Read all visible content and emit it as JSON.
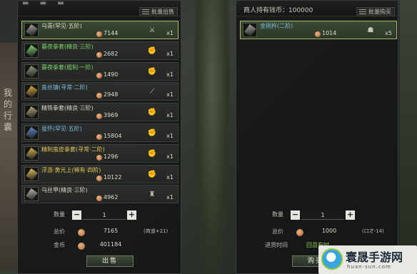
{
  "background": {
    "side_text": [
      "我",
      "的",
      "行",
      "囊"
    ]
  },
  "left_panel": {
    "batch_label": "批量出售",
    "items": [
      {
        "name": "乌青(罕见·五阶)",
        "price": "7144",
        "qty": "x1",
        "type_icon": "sword-icon",
        "color": "white",
        "selected": true
      },
      {
        "name": "暮夜拳套(精良·三阶)",
        "price": "2682",
        "qty": "x1",
        "type_icon": "fist-icon",
        "color": "green"
      },
      {
        "name": "暮夜拳套(粗制·一阶)",
        "price": "1490",
        "qty": "x1",
        "type_icon": "fist-icon",
        "color": "green"
      },
      {
        "name": "蛮丝镰(寻常·二阶)",
        "price": "2948",
        "qty": "x1",
        "type_icon": "blade-icon",
        "color": "blue"
      },
      {
        "name": "精铁拳套(精良·三阶)",
        "price": "3969",
        "qty": "x1",
        "type_icon": "fist-icon",
        "color": "white"
      },
      {
        "name": "虽怀(罕见·五阶)",
        "price": "15804",
        "qty": "x1",
        "type_icon": "fist-icon",
        "color": "blue"
      },
      {
        "name": "精制蛮皮拳套(寻常·二阶)",
        "price": "1296",
        "qty": "x1",
        "type_icon": "fist-icon",
        "color": "gold"
      },
      {
        "name": "浮游·黄元上(稀有·四阶)",
        "price": "10122",
        "qty": "x1",
        "type_icon": "fist-icon",
        "color": "gold"
      },
      {
        "name": "乌丝甲(精良·三阶)",
        "price": "4962",
        "qty": "x1",
        "type_icon": "armor-icon",
        "color": "white"
      }
    ],
    "quantity_label": "数量",
    "quantity_value": "1",
    "total_label": "总价",
    "total_value": "7165",
    "total_note": "(商道+21)",
    "coin_label": "金币",
    "coin_value": "401184",
    "action_label": "出售"
  },
  "right_panel": {
    "merchant_money": "商人持有钱币：100000",
    "batch_label": "批量购买",
    "items": [
      {
        "name": "金刚杵(二阶)",
        "price": "1014",
        "qty": "x5",
        "type_icon": "helmet-icon",
        "color": "blue",
        "selected": true
      }
    ],
    "quantity_label": "数量",
    "quantity_value": "1",
    "total_label": "总价",
    "total_value": "1000",
    "total_note": "(口才-14)",
    "restock_label": "进货时间",
    "restock_value": "回且有时",
    "action_label": "购买"
  },
  "watermark": {
    "title": "寰晟手游网",
    "url": "huan-sun.com"
  }
}
